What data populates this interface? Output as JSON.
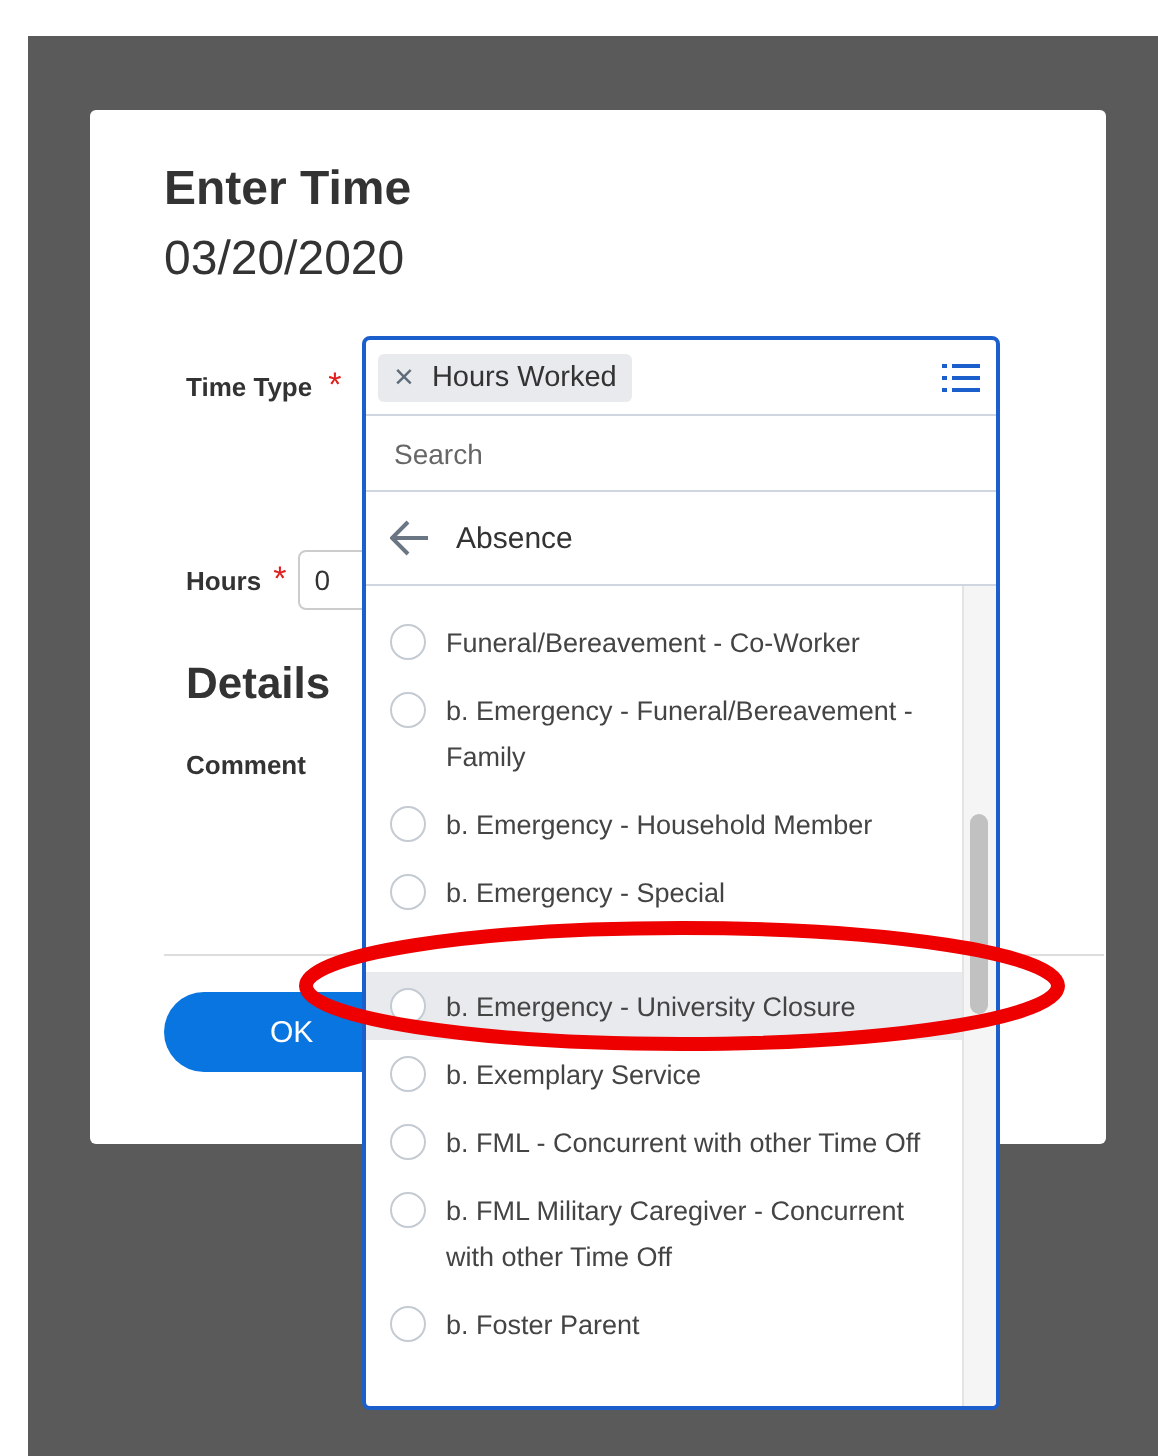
{
  "dialog": {
    "title": "Enter Time",
    "date": "03/20/2020",
    "fields": [
      {
        "label": "Time Type",
        "required": "*"
      },
      {
        "label": "Hours",
        "required": "*",
        "value": "0"
      }
    ],
    "section": "Details",
    "comment_label": "Comment",
    "ok_button": "OK"
  },
  "dropdown": {
    "chip": "Hours Worked",
    "chip_remove": "×",
    "search_placeholder": "Search",
    "category": "Absence",
    "items": [
      {
        "text": "Funeral/Bereavement - Co-Worker",
        "highlighted": false
      },
      {
        "text": "b. Emergency - Funeral/Bereavement - Family",
        "highlighted": false
      },
      {
        "text": "b. Emergency - Household Member",
        "highlighted": false
      },
      {
        "text": "b. Emergency - Special",
        "highlighted": false
      },
      {
        "text": "b. Emergency - University Closure",
        "highlighted": true
      },
      {
        "text": "b. Exemplary Service",
        "highlighted": false
      },
      {
        "text": "b. FML - Concurrent with other Time Off",
        "highlighted": false
      },
      {
        "text": "b. FML Military Caregiver - Concurrent with other Time Off",
        "highlighted": false
      },
      {
        "text": "b. Foster Parent",
        "highlighted": false
      }
    ]
  }
}
